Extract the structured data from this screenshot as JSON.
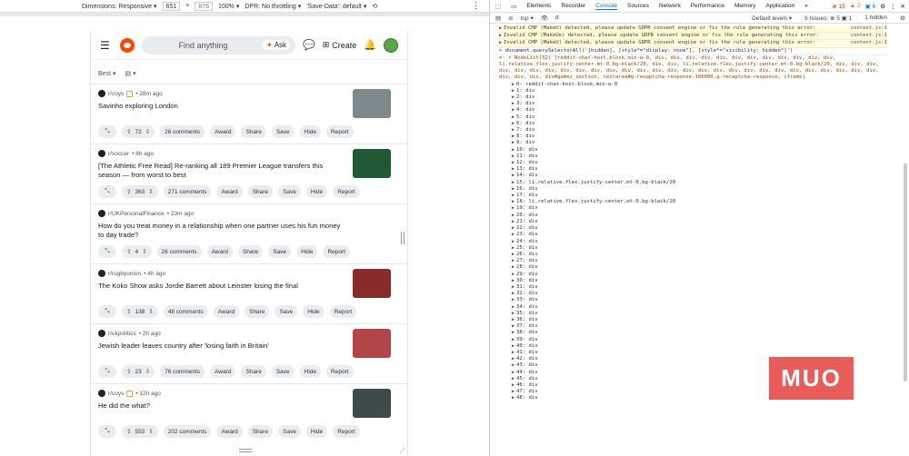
{
  "device_toolbar": {
    "dimensions_label": "Dimensions: Responsive ▾",
    "width": "651",
    "times": "×",
    "height": "876",
    "zoom": "100% ▾",
    "dpr": "DPR: No throttling ▾",
    "save_data": "'Save-Data': default ▾",
    "more": "⋮"
  },
  "reddit": {
    "search_placeholder": "Find anything",
    "ask_label": "Ask",
    "create_label": "Create",
    "sort_label": "Best ▾",
    "view_icon": "▤ ▾",
    "posts": [
      {
        "sub": "r/coys",
        "time": "• 28m ago",
        "title": "Savinho exploring London",
        "votes": "72",
        "comments": "26 comments",
        "award": "Award",
        "share": "Share",
        "save": "Save",
        "hide": "Hide",
        "report": "Report",
        "thumb_color": "#7d8a8c",
        "flair": true
      },
      {
        "sub": "r/soccer",
        "time": "• 6h ago",
        "title": "[The Athletic Free Read] Re-ranking all 189 Premier League transfers this season — from worst to best",
        "votes": "363",
        "comments": "271 comments",
        "award": "Award",
        "share": "Share",
        "save": "Save",
        "hide": "Hide",
        "report": "Report",
        "thumb_color": "#1f5a34",
        "flair": false
      },
      {
        "sub": "r/UKPersonalFinance",
        "time": "• 23m ago",
        "title": "How do you treat money in a relationship when one partner uses his fun money to day trade?",
        "votes": "4",
        "comments": "26 comments",
        "award": "Award",
        "share": "Share",
        "save": "Save",
        "hide": "Hide",
        "report": "Report",
        "thumb_color": "",
        "flair": false
      },
      {
        "sub": "r/rugbyunion",
        "time": "• 4h ago",
        "title": "The Koko Show asks Jordie Barrett about Leinster losing the final",
        "votes": "138",
        "comments": "48 comments",
        "award": "Award",
        "share": "Share",
        "save": "Save",
        "hide": "Hide",
        "report": "Report",
        "thumb_color": "#8a2b2b",
        "flair": false
      },
      {
        "sub": "r/ukpolitics",
        "time": "• 2h ago",
        "title": "Jewish leader leaves country after 'losing faith in Britain'",
        "votes": "23",
        "comments": "76 comments",
        "award": "Award",
        "share": "Share",
        "save": "Save",
        "hide": "Hide",
        "report": "Report",
        "thumb_color": "#b24646",
        "flair": false
      },
      {
        "sub": "r/coys",
        "time": "• 12h ago",
        "title": "He did the what?",
        "votes": "553",
        "comments": "202 comments",
        "award": "Award",
        "share": "Share",
        "save": "Save",
        "hide": "Hide",
        "report": "Report",
        "thumb_color": "#3e4b4a",
        "flair": true
      }
    ]
  },
  "devtools": {
    "tabs": [
      "Elements",
      "Recorder",
      "Console",
      "Sources",
      "Network",
      "Performance",
      "Memory",
      "Application",
      "»"
    ],
    "active_tab": "Console",
    "errors": "⊗ 15",
    "warnings": "▲ 2",
    "issues_badge": "▣ 6",
    "context": "top ▾",
    "filter": "d",
    "levels": "Default levels ▾",
    "issues": "6 Issues: ⊗ 5 ▣ 1",
    "hidden": "1 hidden",
    "warn1": "Invalid CMP (MakeU) detected, please update GDPR consent engine or fix the rule generating this error:",
    "warn2": "Invalid CMP (MakeUe) detected, please update GDPR consent engine or fix the rule generating this error:",
    "warn3": "Invalid CMP (MakeU) detected, please update GDPR consent engine or fix the rule generating this error:",
    "warn_src1": "content.js:1",
    "warn_src2": "content.js:1",
    "warn_src3": "content.js:1",
    "command": "document.querySelectorAll('[hidden], [style*=\"display: none\"], [style*=\"visibility: hidden\"]')",
    "nodelist": "▾ NodeList(52) [reddit-chat-host.block.min-w-0, div, div, div, div, div, div, div, div, div, div, div, div, li.relative.flex.justify-center.mt-0.bg-black/20, div, div, li.relative.flex.justify-center.mt-0.bg-black/20, div, div, div, div, div, div, div, div, div, div, div, div, div, div, div, div, div, div, div, div, div, div, div, div, div, div, div, div, div, div, div, div#gamei_section, textarea#g-recaptcha-response-100000.g-recaptcha-response, iframe]",
    "nodes": [
      "0: reddit-chat-host.block.min-w-0",
      "1: div",
      "2: div",
      "3: div",
      "4: div",
      "5: div",
      "6: div",
      "7: div",
      "8: div",
      "9: div",
      "10: div",
      "11: div",
      "12: div",
      "13: div",
      "14: div",
      "15: li.relative.flex.justify-center.mt-0.bg-black/20",
      "16: div",
      "17: div",
      "18: li.relative.flex.justify-center.mt-0.bg-black/20",
      "19: div",
      "20: div",
      "21: div",
      "22: div",
      "23: div",
      "24: div",
      "25: div",
      "26: div",
      "27: div",
      "28: div",
      "29: div",
      "30: div",
      "31: div",
      "32: div",
      "33: div",
      "34: div",
      "35: div",
      "36: div",
      "37: div",
      "38: div",
      "39: div",
      "40: div",
      "41: div",
      "42: div",
      "43: div",
      "44: div",
      "45: div",
      "46: div",
      "47: div",
      "48: div"
    ]
  },
  "watermark": "MUO"
}
